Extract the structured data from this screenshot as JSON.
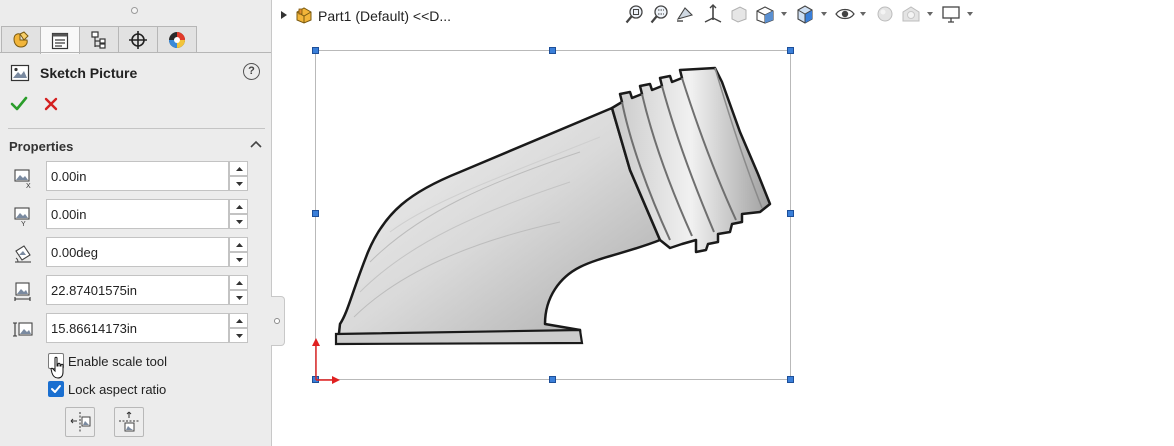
{
  "property_manager": {
    "title": "Sketch Picture",
    "tabs": [
      "feature-manager",
      "property-manager",
      "configuration-manager",
      "dimxpert-manager",
      "display-manager"
    ],
    "active_tab": "property-manager",
    "help": "?",
    "group_title": "Properties",
    "fields": {
      "origin_x": "0.00in",
      "origin_y": "0.00in",
      "angle": "0.00deg",
      "width": "22.87401575in",
      "height": "15.86614173in"
    },
    "enable_scale_tool": {
      "label": "Enable scale tool",
      "checked": false
    },
    "lock_aspect_ratio": {
      "label": "Lock aspect ratio",
      "checked": true
    }
  },
  "graphics": {
    "tree_label": "Part1  (Default) <<D...",
    "view_toolbar_icons": [
      "zoom-to-fit-icon",
      "zoom-to-area-icon",
      "previous-view-icon",
      "section-view-icon",
      "dynamic-annotation-icon",
      "view-orientation-icon",
      "display-style-icon",
      "hide-show-items-icon",
      "edit-appearance-icon",
      "apply-scene-icon",
      "view-settings-icon"
    ]
  },
  "colors": {
    "panel_bg": "#ececec",
    "selection_handle": "#3a7fd9",
    "ok_green": "#2a9d2a",
    "cancel_red": "#d42020",
    "checkbox_blue": "#1a6fd0",
    "origin_red": "#e02020"
  }
}
